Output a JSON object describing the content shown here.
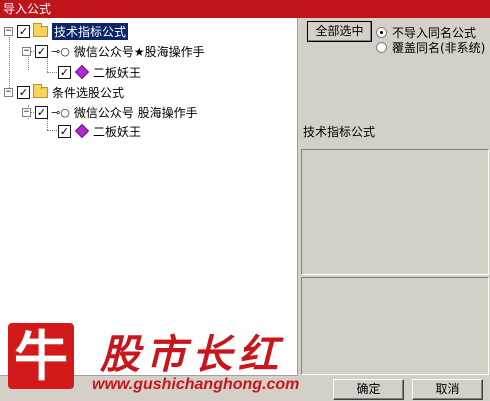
{
  "window": {
    "title": "导入公式"
  },
  "tree": {
    "groups": [
      {
        "label": "技术指标公式",
        "author": "微信公众号★股海操作手",
        "formula": "二板妖王"
      },
      {
        "label": "条件选股公式",
        "author": "微信公众号 股海操作手",
        "formula": "二板妖王"
      }
    ]
  },
  "options": {
    "select_all_label": "全部选中",
    "radio_skip_label": "不导入同名公式",
    "radio_overwrite_label": "覆盖同名(非系统)",
    "selected_radio": "skip"
  },
  "info": {
    "type_label": "技术指标公式"
  },
  "footer": {
    "ok_label": "确定",
    "cancel_label": "取消"
  },
  "watermark": {
    "char": "牛",
    "name": "股市长红",
    "url": "www.gushichanghong.com"
  },
  "colors": {
    "title_bar": "#c0141c",
    "selection": "#0a246a",
    "watermark_red": "#c8161d"
  }
}
